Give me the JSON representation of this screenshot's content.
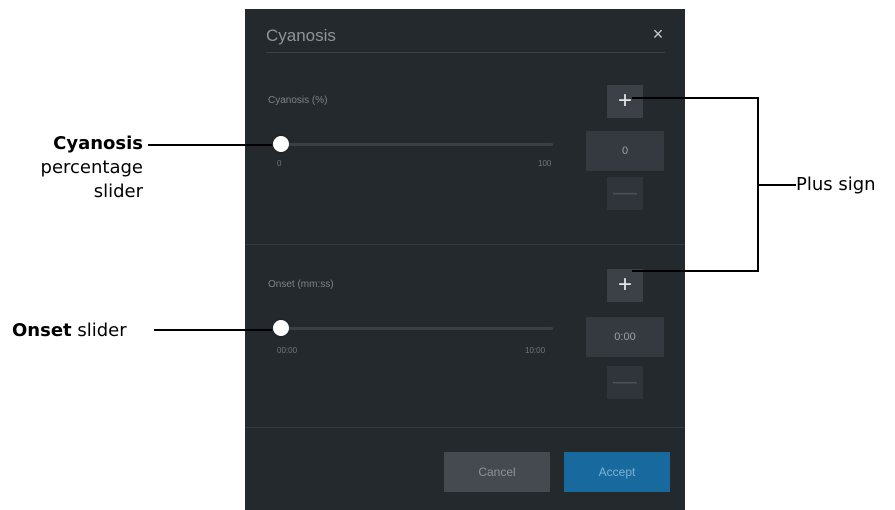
{
  "dialog": {
    "title": "Cyanosis",
    "close_icon": "×",
    "cyanosis": {
      "label": "Cyanosis (%)",
      "min": "0",
      "max": "100",
      "value": "0",
      "level": 0,
      "plus": "+",
      "minus": "—"
    },
    "onset": {
      "label": "Onset (mm:ss)",
      "min": "00:00",
      "max": "10:00",
      "value": "0:00",
      "level": 0,
      "plus": "+",
      "minus": "—"
    },
    "cancel": "Cancel",
    "accept": "Accept"
  },
  "annotations": {
    "cyanosis_bold": "Cyanosis",
    "cyanosis_rest_1": "percentage",
    "cyanosis_rest_2": "slider",
    "onset_bold": "Onset",
    "onset_rest": " slider",
    "plus_sign": "Plus sign"
  },
  "colors": {
    "panel_bg": "#24292e",
    "accent": "#17699e"
  }
}
